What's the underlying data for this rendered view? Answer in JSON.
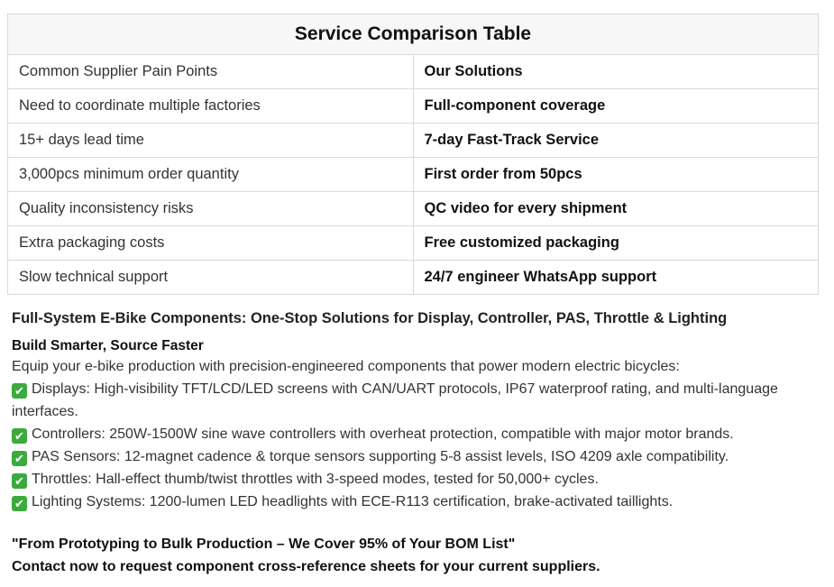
{
  "table": {
    "title": "Service Comparison Table",
    "headers": [
      "Common Supplier Pain Points",
      "Our Solutions"
    ],
    "rows": [
      [
        "Need to coordinate multiple factories",
        "Full-component coverage"
      ],
      [
        "15+ days lead time",
        "7-day Fast-Track Service"
      ],
      [
        "3,000pcs minimum order quantity",
        "First order from 50pcs"
      ],
      [
        "Quality inconsistency risks",
        "QC video for every shipment"
      ],
      [
        "Extra packaging costs",
        "Free customized packaging"
      ],
      [
        "Slow technical support",
        "24/7 engineer WhatsApp support"
      ]
    ]
  },
  "section": {
    "heading": "Full-System E-Bike Components: One-Stop Solutions for Display, Controller, PAS, Throttle & Lighting",
    "subheading": "Build Smarter, Source Faster",
    "intro": "Equip your e-bike production with precision-engineered components that power modern electric bicycles:",
    "check_glyph": "✔",
    "features": [
      "Displays: High-visibility TFT/LCD/LED screens with CAN/UART protocols, IP67 waterproof rating, and multi-language interfaces.",
      "Controllers: 250W-1500W sine wave controllers with overheat protection, compatible with major motor brands.",
      "PAS Sensors: 12-magnet cadence & torque sensors supporting 5-8 assist levels, ISO 4209 axle compatibility.",
      "Throttles: Hall-effect thumb/twist throttles with 3-speed modes, tested for 50,000+ cycles.",
      "Lighting Systems: 1200-lumen LED headlights with ECE-R113 certification, brake-activated taillights."
    ],
    "quote": "\"From Prototyping to Bulk Production – We Cover 95% of Your BOM List\"",
    "contact": "Contact now to request component cross-reference sheets for your current suppliers."
  },
  "colors": {
    "check_green": "#3bab3e",
    "title_bg": "#f7f7f7",
    "border": "#d9d9d9"
  }
}
